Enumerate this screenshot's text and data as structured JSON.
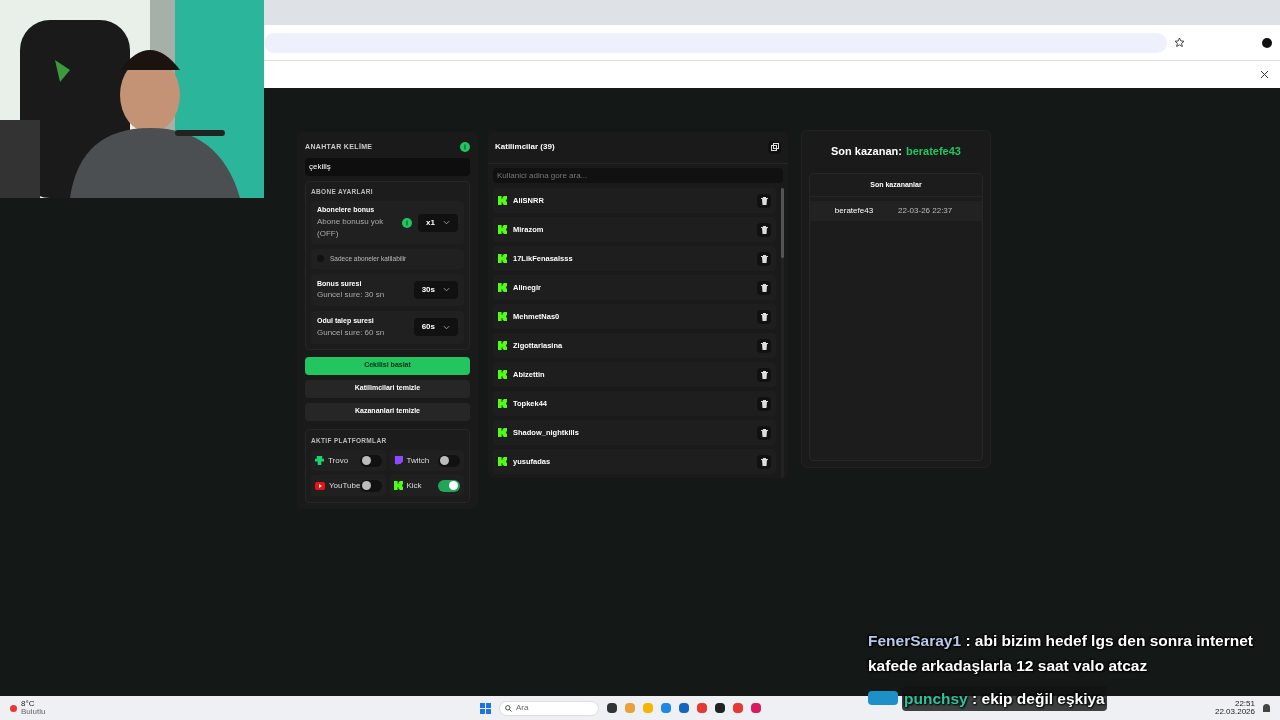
{
  "keyword": {
    "label": "ANAHTAR KELİME",
    "value": "çekiliş"
  },
  "subscriber_settings": {
    "title": "ABONE AYARLARI",
    "bonus": {
      "title": "Abonelere bonus",
      "subtitle": "Abone bonusu yok (OFF)",
      "value": "x1"
    },
    "only_subscribers": {
      "label": "Sadece aboneler katilabilir",
      "checked": false
    },
    "durations": [
      {
        "title": "Bonus suresi",
        "subtitle": "Guncel sure: 30 sn",
        "value": "30s"
      },
      {
        "title": "Odul talep suresi",
        "subtitle": "Guncel sure: 60 sn",
        "value": "60s"
      }
    ]
  },
  "buttons": [
    {
      "label": "Cekilisi baslat",
      "kind": "primary"
    },
    {
      "label": "Katilimcilari temizle",
      "kind": "secondary"
    },
    {
      "label": "Kazananlari temizle",
      "kind": "secondary"
    }
  ],
  "platforms": {
    "title": "AKTIF PLATFORMLAR",
    "items": [
      {
        "name": "Trovo",
        "kind": "trovo",
        "on": false
      },
      {
        "name": "Twitch",
        "kind": "twitch",
        "on": false
      },
      {
        "name": "YouTube",
        "kind": "youtube",
        "on": false
      },
      {
        "name": "Kick",
        "kind": "kick",
        "on": true
      }
    ]
  },
  "participants": {
    "title": "Katilimcilar (39)",
    "search_placeholder": "Kullanici adina gore ara...",
    "items": [
      "AliSNRR",
      "Mirazom",
      "17LikFenasalsss",
      "Alinegir",
      "MehmetNas0",
      "Zigottarlasina",
      "Abizettin",
      "Topkek44",
      "Shadow_nightkills",
      "yusufadas"
    ]
  },
  "winner": {
    "label": "Son kazanan:",
    "name": "beratefe43",
    "table_title": "Son kazananlar",
    "rows": [
      {
        "name": "beratefe43",
        "time": "22-03-26 22:37"
      }
    ]
  },
  "chat": [
    {
      "user": "FenerSaray1",
      "text": ": abi bizim hedef lgs den sonra internet kafede arkadaşlarla 12 saat valo atcaz",
      "color": "#b8c8e8",
      "badges": false
    },
    {
      "user": "punchsy",
      "text": ": ekip değil eşkiya",
      "color": "#2ec4a0",
      "badges": true
    }
  ],
  "taskbar": {
    "weather": "8°C",
    "weather_text": "Bulutlu",
    "search_placeholder": "Ara",
    "time": "22:51",
    "date": "22.03.2026"
  }
}
